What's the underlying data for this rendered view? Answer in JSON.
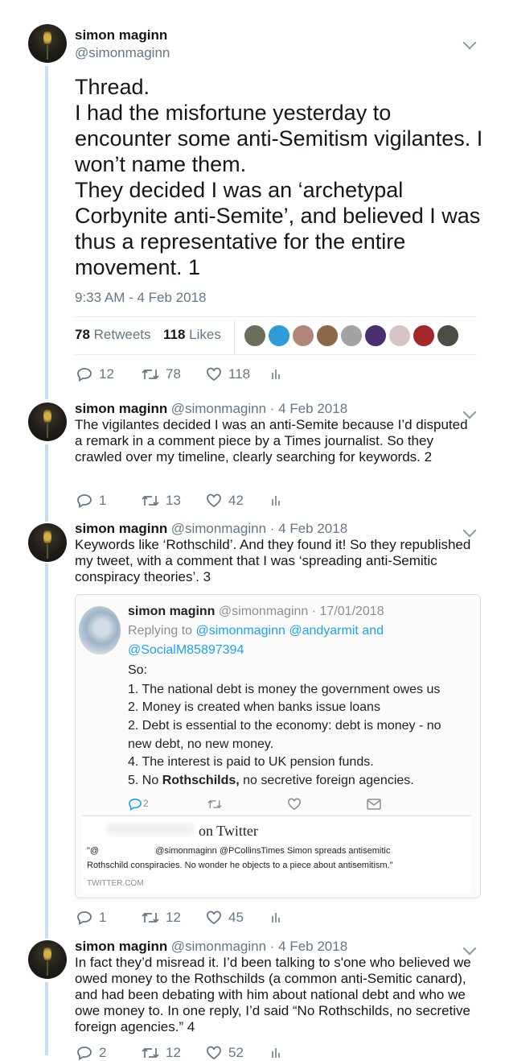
{
  "tweets": [
    {
      "name": "simon maginn",
      "handle": "@simonmaginn",
      "text": "Thread.\nI had the misfortune yesterday to encounter some anti-Semitism vigilantes. I won’t name them.\nThey decided I was an ‘archetypal Corbynite anti-Semite’, and believed I was thus a representative for the entire movement. 1",
      "timestamp": "9:33 AM - 4 Feb 2018",
      "retweets_count": "78",
      "retweets_label": "Retweets",
      "likes_count": "118",
      "likes_label": "Likes",
      "actions": {
        "reply": "12",
        "retweet": "78",
        "like": "118"
      }
    },
    {
      "name": "simon maginn",
      "handle_date": "@simonmaginn · 4 Feb 2018",
      "text": "The vigilantes decided I was an anti-Semite because I’d disputed a remark in a comment piece  by a Times journalist. So they crawled over my timeline, clearly searching for keywords. 2",
      "actions": {
        "reply": "1",
        "retweet": "13",
        "like": "42"
      }
    },
    {
      "name": "simon maginn",
      "handle_date": "@simonmaginn · 4 Feb 2018",
      "text": "Keywords like ‘Rothschild’. And they found it! So they republished my tweet, with a comment that I was ‘spreading anti-Semitic conspiracy theories’. 3",
      "actions": {
        "reply": "1",
        "retweet": "12",
        "like": "45"
      }
    },
    {
      "name": "simon maginn",
      "handle_date": "@simonmaginn · 4 Feb 2018",
      "text": "In fact they’d misread it. I’d been talking to s'one who believed we owed money to the Rothschilds (a common anti-Semitic canard), and had been debating with him about national debt and who we owe money to. In one reply, I’d said “No Rothschilds, no secretive foreign agencies.” 4",
      "actions": {
        "reply": "2",
        "retweet": "12",
        "like": "52"
      }
    }
  ],
  "embed": {
    "name": "simon maginn",
    "handle_date": "@simonmaginn · 17/01/2018",
    "replying_prefix": "Replying to",
    "replying_to_1": "@simonmaginn @andyarmit",
    "replying_and": "and",
    "replying_to_2": "@SocialM85897394",
    "lines": [
      "So:",
      "1. The national debt is money the government owes us",
      "2. Money is created when banks issue loans",
      "2. Debt is essential to the economy: debt is money - no",
      "new debt, no new money.",
      "4. The interest is paid to UK pension funds."
    ],
    "line5_prefix": "5. No ",
    "line5_bold": "Rothschilds,",
    "line5_suffix": " no secretive foreign agencies.",
    "reply_count": "2",
    "card_title": "on Twitter",
    "card_quote_open": "\"@",
    "card_quote_mid": "@simonmaginn @PCollinsTimes Simon spreads antisemitic",
    "card_quote_line2": "Rothschild conspiracies. No wonder he objects to a piece about antisemitism.\"",
    "card_domain": "TWITTER.COM"
  },
  "liker_avatar_colors": [
    "#6d6d5c",
    "#2f9bd8",
    "#b0867a",
    "#8b6a4c",
    "#a3a3a3",
    "#4a2f6e",
    "#d8c4c6",
    "#a3262a",
    "#4d4d45"
  ],
  "colors": {
    "thread_line": "#c4dff2",
    "link_blue": "#1da1f2",
    "meta_gray": "#657786"
  }
}
